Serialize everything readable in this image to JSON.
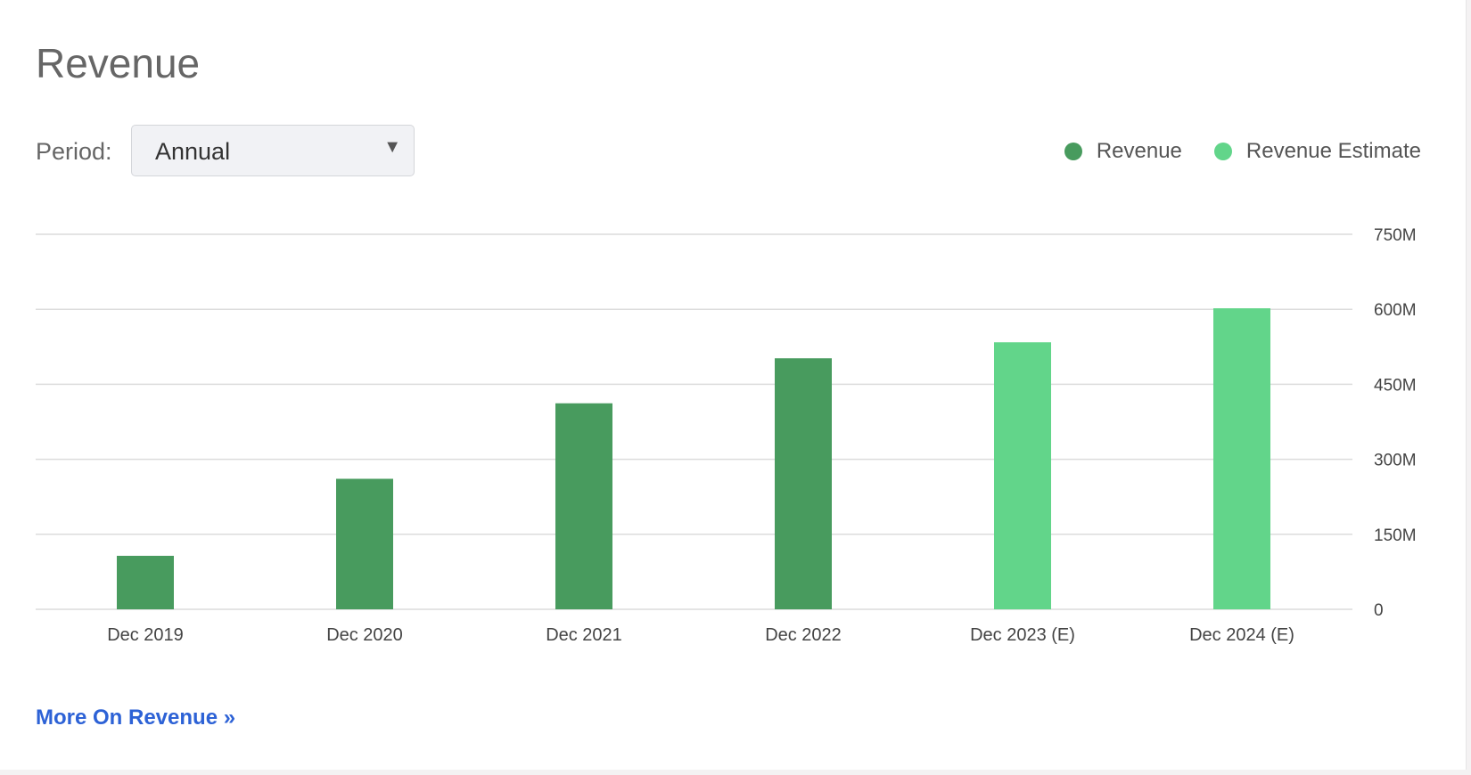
{
  "header": {
    "title": "Revenue"
  },
  "controls": {
    "period_label": "Period:",
    "period_value": "Annual",
    "caret": "▼"
  },
  "legend": [
    {
      "label": "Revenue",
      "color": "#489b5e"
    },
    {
      "label": "Revenue Estimate",
      "color": "#62d58a"
    }
  ],
  "chart_data": {
    "type": "bar",
    "title": "Revenue",
    "categories": [
      "Dec 2019",
      "Dec 2020",
      "Dec 2021",
      "Dec 2022",
      "Dec 2023 (E)",
      "Dec 2024 (E)"
    ],
    "series": [
      {
        "name": "Revenue",
        "values": [
          107,
          261,
          412,
          502,
          null,
          null
        ],
        "color": "#489b5e"
      },
      {
        "name": "Revenue Estimate",
        "values": [
          null,
          null,
          null,
          null,
          534,
          602
        ],
        "color": "#62d58a"
      }
    ],
    "unit": "M",
    "ylim": [
      0,
      750
    ],
    "yticks": [
      0,
      150,
      300,
      450,
      600,
      750
    ],
    "ytick_labels": [
      "0",
      "150M",
      "300M",
      "450M",
      "600M",
      "750M"
    ],
    "grid": true,
    "legend_position": "top-right"
  },
  "footer": {
    "more_link": "More On Revenue »"
  }
}
